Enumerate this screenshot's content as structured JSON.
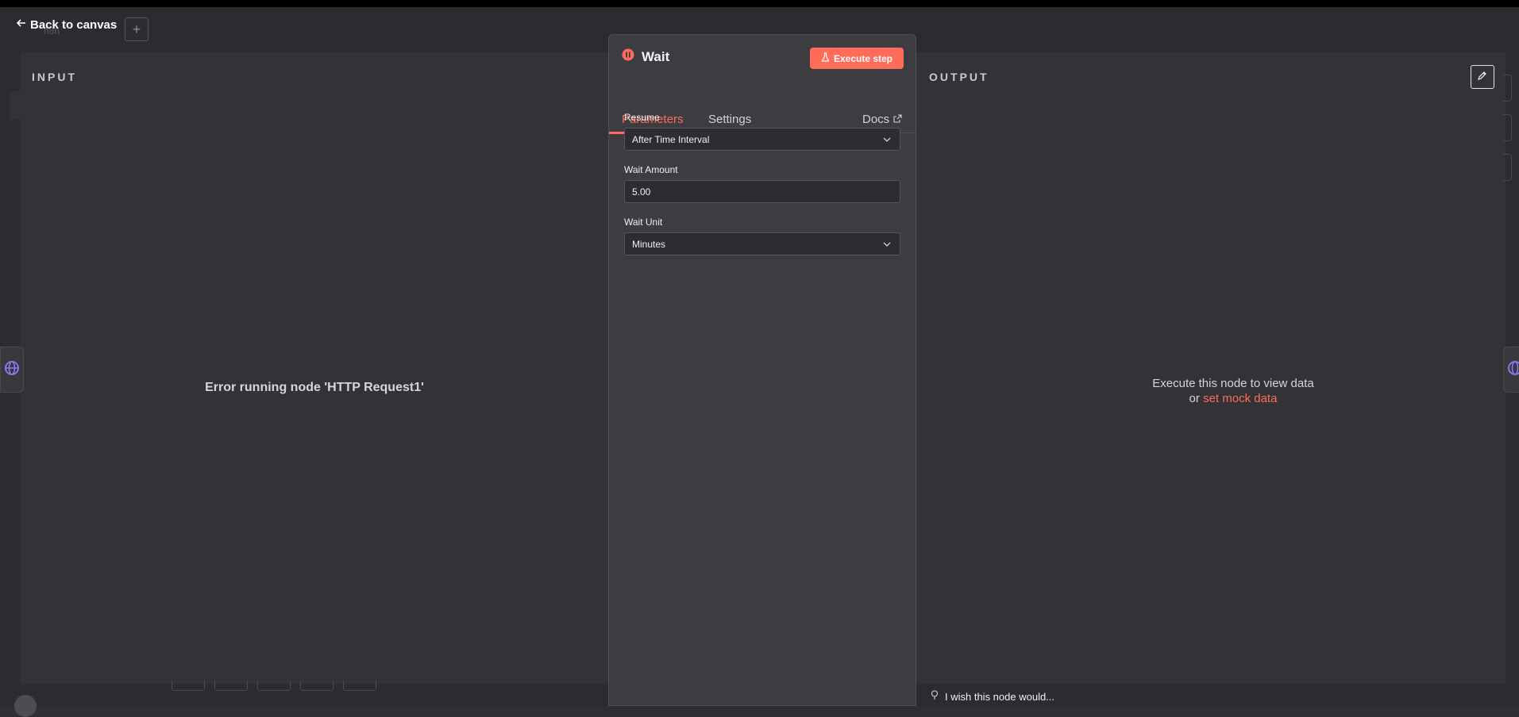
{
  "nav": {
    "back_label": "Back to canvas",
    "add_label": "+",
    "ghost_title": "n8n"
  },
  "input_panel": {
    "label": "INPUT",
    "message": "Error running node 'HTTP Request1'"
  },
  "output_panel": {
    "label": "OUTPUT",
    "message": "Execute this node to view data",
    "or_text": "or",
    "mock_link": "set mock data"
  },
  "node": {
    "title": "Wait",
    "execute_label": "Execute step",
    "tabs": [
      {
        "label": "Parameters",
        "active": true
      },
      {
        "label": "Settings",
        "active": false
      }
    ],
    "docs_label": "Docs",
    "fields": {
      "resume": {
        "label": "Resume",
        "value": "After Time Interval"
      },
      "wait_amount": {
        "label": "Wait Amount",
        "value": "5.00"
      },
      "wait_unit": {
        "label": "Wait Unit",
        "value": "Minutes"
      }
    }
  },
  "footer": {
    "wish_label": "I wish this node would..."
  },
  "colors": {
    "accent": "#ff6d5a",
    "panel_bg": "#333337",
    "node_bg": "#3c3c41"
  },
  "icons": [
    "arrow-left-icon",
    "pause-icon",
    "flask-icon",
    "external-link-icon",
    "chevron-down-icon",
    "pencil-icon",
    "globe-icon",
    "lightbulb-icon"
  ]
}
